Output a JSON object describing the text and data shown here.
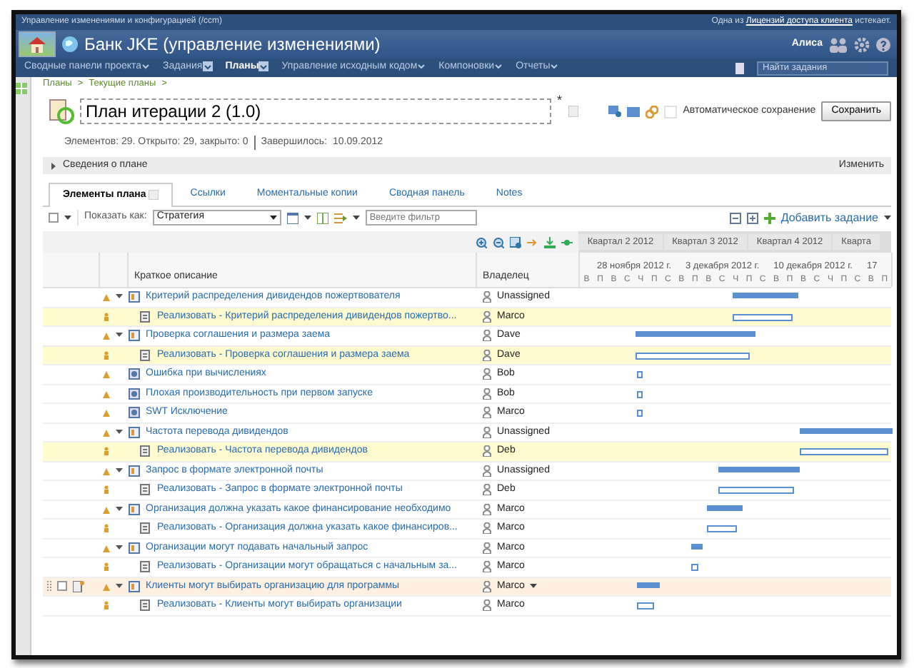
{
  "app_header": {
    "title": "Управление изменениями и конфигурацией (/ccm)",
    "notice_before": "Одна из",
    "notice_link": "Лицензий доступа клиента",
    "notice_after": "истекает."
  },
  "banner": {
    "title": "Банк JKE (управление изменениями)",
    "user": "Алиса"
  },
  "nav": [
    {
      "label": "Сводные панели проекта",
      "kind": "menu",
      "selected": false
    },
    {
      "label": "Задания",
      "kind": "favorite",
      "selected": false
    },
    {
      "label": "Планы",
      "kind": "favorite",
      "selected": true
    },
    {
      "label": "Управление исходным кодом",
      "kind": "menu",
      "selected": false
    },
    {
      "label": "Компоновки",
      "kind": "menu",
      "selected": false
    },
    {
      "label": "Отчеты",
      "kind": "menu",
      "selected": false
    }
  ],
  "search": {
    "placeholder": "Найти задания"
  },
  "breadcrumb": [
    {
      "label": "Планы"
    },
    {
      "label": "Текущие планы"
    }
  ],
  "breadcrumb_separator": ">",
  "plan": {
    "title": "План итерации 2 (1.0)",
    "dirty_mark": "*",
    "autosave_label": "Автоматическое сохранение",
    "autosave": false,
    "save_button": "Сохранить",
    "stats": "Элементов: 29. Открыто: 29, закрыто: 0",
    "finished_label": "Завершилось:",
    "finished_date": "10.09.2012"
  },
  "section": {
    "label": "Сведения о плане",
    "expanded": false,
    "edit_link": "Изменить"
  },
  "tabs": [
    {
      "label": "Элементы плана",
      "selected": true
    },
    {
      "label": "Ссылки",
      "selected": false
    },
    {
      "label": "Моментальные копии",
      "selected": false
    },
    {
      "label": "Сводная панель",
      "selected": false
    },
    {
      "label": "Notes",
      "selected": false
    }
  ],
  "toolbar": {
    "show_as_label": "Показать как:",
    "view": "Стратегия",
    "filter_placeholder": "Введите фильтр",
    "add_button": "Добавить задание"
  },
  "timeline": {
    "quarters": [
      "Квартал 2 2012",
      "Квартал 3 2012",
      "Квартал 4 2012",
      "Кварта"
    ],
    "weeks": [
      "28 ноября 2012 г.",
      "3 декабря 2012 г.",
      "10 декабря 2012 г.",
      "17"
    ],
    "days": [
      "В",
      "П",
      "В",
      "С",
      "Ч",
      "П",
      "С",
      "В",
      "П",
      "В",
      "С",
      "Ч",
      "П",
      "С",
      "В",
      "П",
      "В",
      "С",
      "Ч",
      "П",
      "С",
      "В",
      "П"
    ]
  },
  "columns": [
    "Краткое описание",
    "Владелец"
  ],
  "rows": [
    {
      "kind": "story",
      "title": "Критерий распределения дивидендов пожертвователя",
      "owner": "Unassigned",
      "expanded": true,
      "highlighted": false,
      "hovered": false
    },
    {
      "kind": "task",
      "title": "Реализовать - Критерий распределения дивидендов пожертво...",
      "owner": "Marco",
      "highlighted": true,
      "hovered": false
    },
    {
      "kind": "story",
      "title": "Проверка соглашения и размера заема",
      "owner": "Dave",
      "expanded": true,
      "highlighted": false,
      "hovered": false
    },
    {
      "kind": "task",
      "title": "Реализовать - Проверка соглашения и размера заема",
      "owner": "Dave",
      "highlighted": true,
      "hovered": false
    },
    {
      "kind": "defect",
      "title": "Ошибка при вычислениях",
      "owner": "Bob",
      "highlighted": false,
      "hovered": false
    },
    {
      "kind": "defect",
      "title": "Плохая производительность при первом запуске",
      "owner": "Bob",
      "highlighted": false,
      "hovered": false
    },
    {
      "kind": "defect",
      "title": "SWT Исключение",
      "owner": "Marco",
      "highlighted": false,
      "hovered": false
    },
    {
      "kind": "story",
      "title": "Частота перевода дивидендов",
      "owner": "Unassigned",
      "expanded": true,
      "highlighted": false,
      "hovered": false
    },
    {
      "kind": "task",
      "title": "Реализовать - Частота перевода дивидендов",
      "owner": "Deb",
      "highlighted": true,
      "hovered": false
    },
    {
      "kind": "story",
      "title": "Запрос в формате электронной почты",
      "owner": "Unassigned",
      "expanded": true,
      "highlighted": false,
      "hovered": false
    },
    {
      "kind": "task",
      "title": "Реализовать - Запрос в формате электронной почты",
      "owner": "Deb",
      "highlighted": false,
      "hovered": false
    },
    {
      "kind": "story",
      "title": "Организация должна указать какое финансирование необходимо",
      "owner": "Marco",
      "expanded": true,
      "highlighted": false,
      "hovered": false
    },
    {
      "kind": "task",
      "title": "Реализовать - Организация должна указать какое финансиров...",
      "owner": "Marco",
      "highlighted": false,
      "hovered": false
    },
    {
      "kind": "story",
      "title": "Организации могут подавать начальный запрос",
      "owner": "Marco",
      "expanded": true,
      "highlighted": false,
      "hovered": false
    },
    {
      "kind": "task",
      "title": "Реализовать - Организации могут обращаться с начальным за...",
      "owner": "Marco",
      "highlighted": false,
      "hovered": false
    },
    {
      "kind": "story",
      "title": "Клиенты могут выбирать организацию для программы",
      "owner": "Marco",
      "expanded": true,
      "highlighted": false,
      "hovered": true
    },
    {
      "kind": "task",
      "title": "Реализовать - Клиенты могут выбирать организации",
      "owner": "Marco",
      "highlighted": false,
      "hovered": false
    }
  ]
}
